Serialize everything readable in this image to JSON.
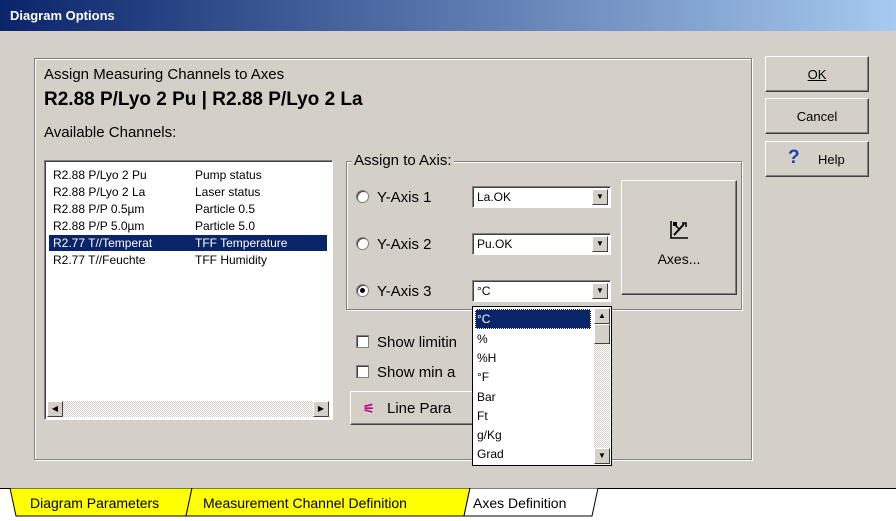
{
  "window": {
    "title": "Diagram Options"
  },
  "panel": {
    "heading": "Assign Measuring Channels to Axes",
    "selection": "R2.88 P/Lyo 2 Pu | R2.88 P/Lyo 2 La",
    "available_label": "Available Channels:"
  },
  "channels": [
    {
      "id": "R2.88 P/Lyo 2 Pu",
      "desc": "Pump status"
    },
    {
      "id": "R2.88 P/Lyo 2 La",
      "desc": "Laser status"
    },
    {
      "id": "R2.88 P/P 0.5µm",
      "desc": "Particle 0.5"
    },
    {
      "id": "R2.88 P/P 5.0µm",
      "desc": "Particle 5.0"
    },
    {
      "id": "R2.77 T//Temperat",
      "desc": "TFF Temperature"
    },
    {
      "id": "R2.77 T//Feuchte",
      "desc": "TFF Humidity"
    }
  ],
  "assign": {
    "legend": "Assign to Axis:",
    "axis1": {
      "label": "Y-Axis 1",
      "value": "La.OK"
    },
    "axis2": {
      "label": "Y-Axis 2",
      "value": "Pu.OK"
    },
    "axis3": {
      "label": "Y-Axis 3",
      "value": "°C"
    },
    "axes_button": "Axes..."
  },
  "options": {
    "show_limits": "Show limitin",
    "show_minmax": "Show min a"
  },
  "line_params_button": "Line Para",
  "unit_dropdown": [
    "°C",
    "%",
    "%H",
    "°F",
    "Bar",
    "Ft",
    "g/Kg",
    "Grad"
  ],
  "buttons": {
    "ok": "OK",
    "cancel": "Cancel",
    "help": "Help"
  },
  "tabs": [
    "Diagram Parameters",
    "Measurement Channel Definition",
    "Axes Definition"
  ],
  "colors": {
    "selection": "#0a246a",
    "tab_inactive": "#ffff00",
    "dialog": "#d4d0c8"
  }
}
